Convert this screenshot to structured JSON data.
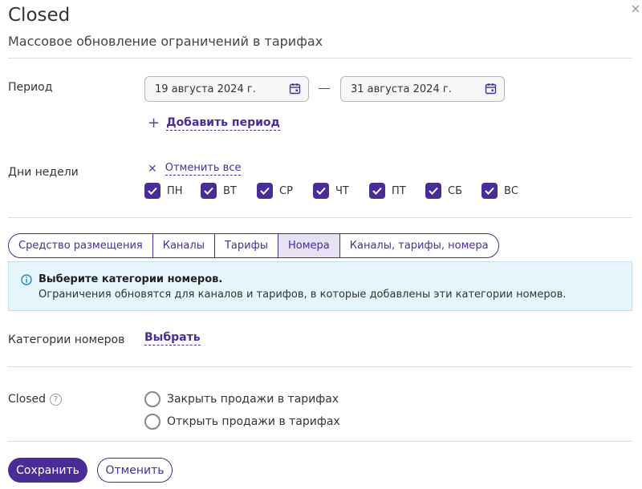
{
  "dialog": {
    "title": "Closed",
    "subtitle": "Массовое обновление ограничений в тарифах"
  },
  "period": {
    "label": "Период",
    "start_date": "19 августа 2024 г.",
    "end_date": "31 августа 2024 г.",
    "add_link": "Добавить период"
  },
  "weekdays": {
    "label": "Дни недели",
    "unselect_all": "Отменить все",
    "days": [
      {
        "label": "ПН",
        "checked": true
      },
      {
        "label": "ВТ",
        "checked": true
      },
      {
        "label": "СР",
        "checked": true
      },
      {
        "label": "ЧТ",
        "checked": true
      },
      {
        "label": "ПТ",
        "checked": true
      },
      {
        "label": "СБ",
        "checked": true
      },
      {
        "label": "ВС",
        "checked": true
      }
    ]
  },
  "tabs": {
    "items": [
      {
        "label": "Средство размещения",
        "active": false
      },
      {
        "label": "Каналы",
        "active": false
      },
      {
        "label": "Тарифы",
        "active": false
      },
      {
        "label": "Номера",
        "active": true
      },
      {
        "label": "Каналы, тарифы, номера",
        "active": false
      }
    ]
  },
  "info": {
    "heading": "Выберите категории номеров.",
    "body": "Ограничения обновятся для каналов и тарифов, в которые добавлены эти категории номеров."
  },
  "room_categories": {
    "label": "Категории номеров",
    "select_link": "Выбрать"
  },
  "closed": {
    "label": "Closed",
    "help_icon": "?",
    "options": [
      {
        "label": "Закрыть продажи в тарифах",
        "selected": false
      },
      {
        "label": "Открыть продажи в тарифах",
        "selected": false
      }
    ]
  },
  "actions": {
    "save": "Сохранить",
    "cancel": "Отменить"
  },
  "colors": {
    "accent": "#4a2c97",
    "info_bg": "#e6f4fb",
    "active_tab_bg": "#e6e1f3"
  }
}
